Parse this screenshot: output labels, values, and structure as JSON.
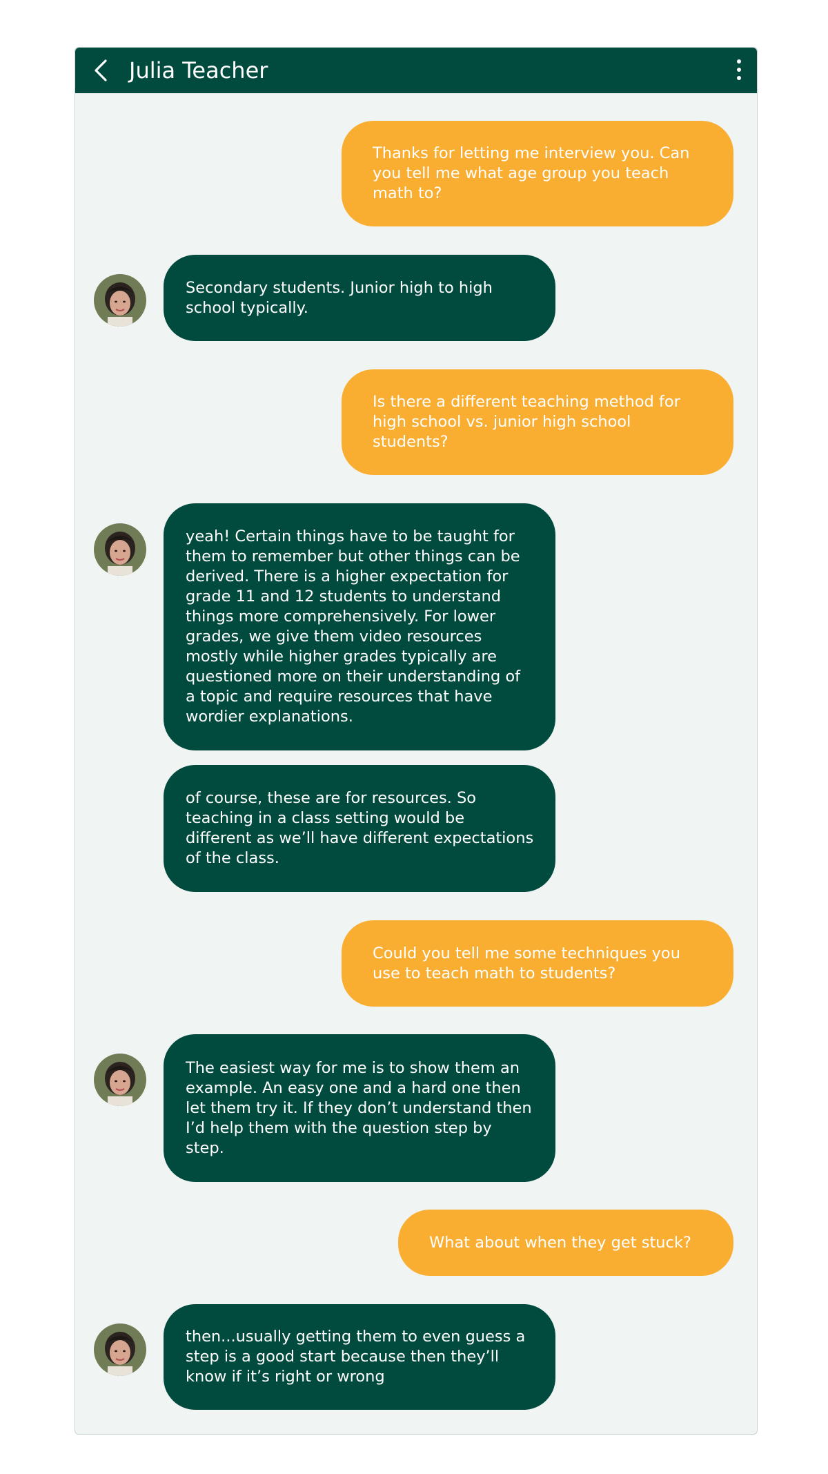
{
  "header": {
    "title": "Julia Teacher",
    "back_icon": "chevron-left-icon",
    "menu_icon": "more-vertical-icon",
    "color": "#014a3e"
  },
  "colors": {
    "outgoing_bubble": "#f9ae32",
    "incoming_bubble": "#014a3e",
    "chat_background": "#f0f4f2"
  },
  "messages": [
    {
      "sender": "me",
      "text": "Thanks for letting me interview you. Can you tell me what age group you teach math to?"
    },
    {
      "sender": "Julia Teacher",
      "text": "Secondary students. Junior high to high school typically."
    },
    {
      "sender": "me",
      "text": "Is there a different teaching method for high school vs. junior high school students?"
    },
    {
      "sender": "Julia Teacher",
      "text": "yeah! Certain things have to be taught for them to remember but other things can be derived. There is a higher expectation for grade 11 and 12 students to understand things more comprehensively. For lower grades, we give them video resources mostly while higher grades typically are questioned more on their understanding of a topic and require resources that have wordier explanations."
    },
    {
      "sender": "Julia Teacher",
      "text": "of course, these are for resources. So teaching in a class setting would be different as we’ll have different expectations of the class."
    },
    {
      "sender": "me",
      "text": "Could you tell me some techniques you use to teach math to students?"
    },
    {
      "sender": "Julia Teacher",
      "text": "The easiest way for me is to show them an example. An easy one and a hard one then let them try it. If they don’t understand then I’d help them with the question step by step."
    },
    {
      "sender": "me",
      "text": "What about when they get stuck?"
    },
    {
      "sender": "Julia Teacher",
      "text": "then...usually getting them to even guess a step is a good start because then they’ll know if it’s right or wrong"
    }
  ]
}
